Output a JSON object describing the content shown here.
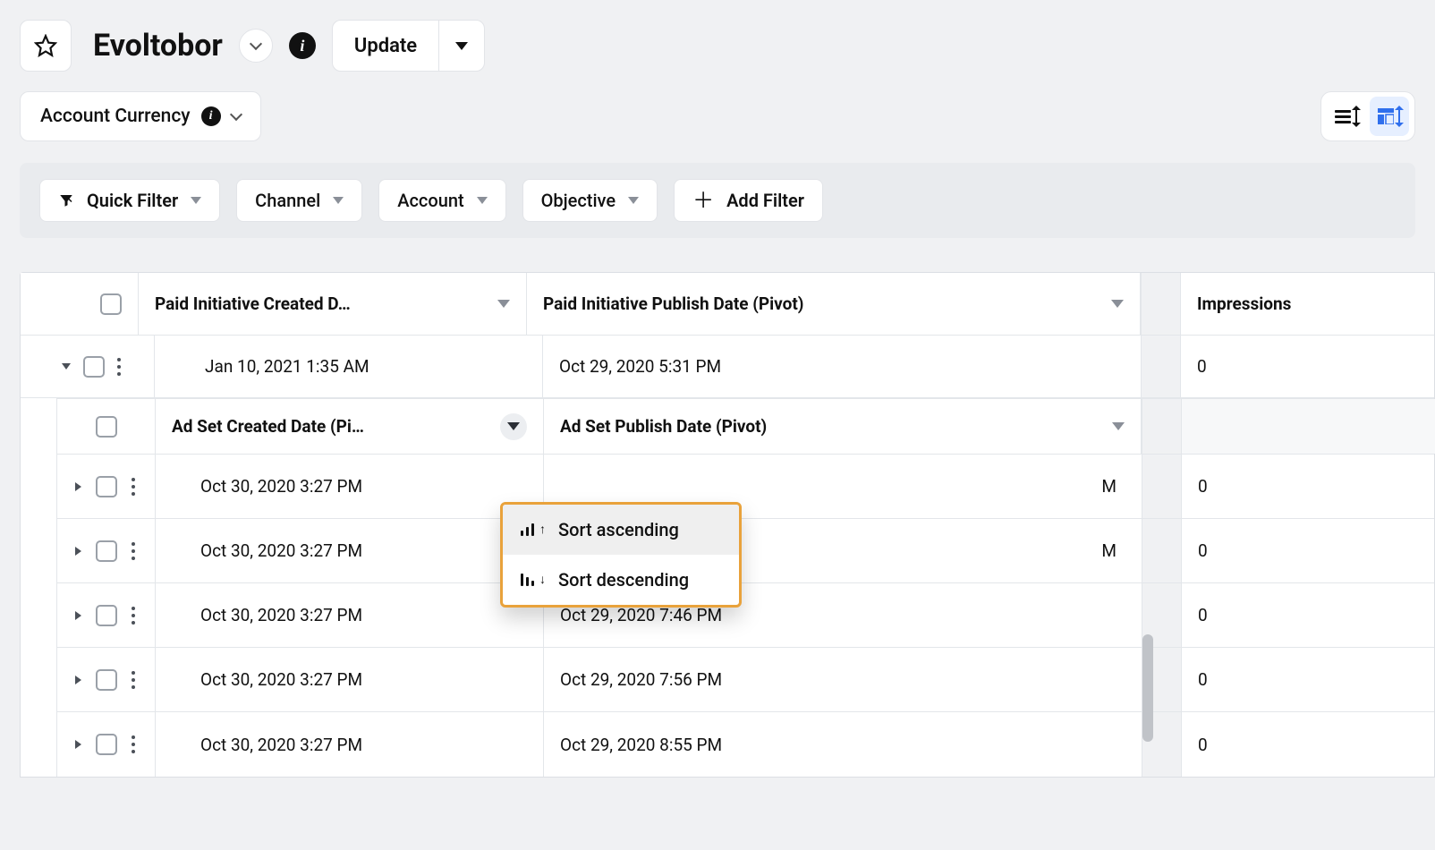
{
  "header": {
    "title": "Evoltobor",
    "update_label": "Update"
  },
  "secondary": {
    "currency_label": "Account Currency"
  },
  "filters": {
    "quick_filter": "Quick Filter",
    "channel": "Channel",
    "account": "Account",
    "objective": "Objective",
    "add_filter": "Add Filter"
  },
  "columns": {
    "initiative_created": "Paid Initiative Created D…",
    "initiative_publish": "Paid Initiative Publish Date (Pivot)",
    "impressions": "Impressions",
    "adset_created": "Ad Set Created Date (Pi…",
    "adset_publish": "Ad Set Publish Date (Pivot)"
  },
  "menu": {
    "sort_asc": "Sort ascending",
    "sort_desc": "Sort descending"
  },
  "rows": {
    "top": {
      "created": "Jan 10, 2021 1:35 AM",
      "publish": "Oct 29, 2020 5:31 PM",
      "impressions": "0"
    },
    "adsets": [
      {
        "created": "Oct 30, 2020 3:27 PM",
        "publish": "M",
        "impressions": "0"
      },
      {
        "created": "Oct 30, 2020 3:27 PM",
        "publish": "M",
        "impressions": "0"
      },
      {
        "created": "Oct 30, 2020 3:27 PM",
        "publish": "Oct 29, 2020 7:46 PM",
        "impressions": "0"
      },
      {
        "created": "Oct 30, 2020 3:27 PM",
        "publish": "Oct 29, 2020 7:56 PM",
        "impressions": "0"
      },
      {
        "created": "Oct 30, 2020 3:27 PM",
        "publish": "Oct 29, 2020 8:55 PM",
        "impressions": "0"
      }
    ]
  }
}
